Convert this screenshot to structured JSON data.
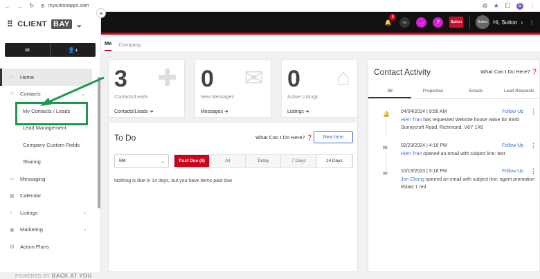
{
  "browser": {
    "url": "mysuttonapps.com",
    "profile_initial": "S"
  },
  "brand": {
    "name": "CLIENT",
    "accent": "BAY"
  },
  "sidebar": {
    "items": [
      {
        "label": "Home",
        "icon": "home-icon"
      },
      {
        "label": "Contacts",
        "icon": "contacts-icon"
      },
      {
        "label": "My Contacts / Leads"
      },
      {
        "label": "Lead Management"
      },
      {
        "label": "Company Custom Fields"
      },
      {
        "label": "Sharing"
      },
      {
        "label": "Messaging",
        "icon": "messaging-icon"
      },
      {
        "label": "Calendar",
        "icon": "calendar-icon"
      },
      {
        "label": "Listings",
        "icon": "listings-icon"
      },
      {
        "label": "Marketing",
        "icon": "marketing-icon"
      },
      {
        "label": "Action Plans",
        "icon": "action-plans-icon"
      }
    ],
    "powered_by": "POWERED BY",
    "powered_brand": "BACK AT YOU"
  },
  "topbar": {
    "notification_count": "8",
    "user_greeting": "Hi, Sutton",
    "brand_badge": "Sutton",
    "avatar_text": "Sutton"
  },
  "tabs": {
    "me": "Me",
    "company": "Company"
  },
  "stats": [
    {
      "value": "3",
      "label": "Contacts/Leads",
      "link": "Contacts/Leads"
    },
    {
      "value": "0",
      "label": "New Messages",
      "link": "Messages"
    },
    {
      "value": "0",
      "label": "Active Listings",
      "link": "Listings"
    }
  ],
  "todo": {
    "title": "To Do",
    "what": "What Can I Do Here?",
    "new_item": "New Item",
    "filter": "Me",
    "ranges": [
      "Past Due (8)",
      "All",
      "Today",
      "7 Days",
      "14 Days"
    ],
    "message": "Nothing is due in 14 days, but you have items past due"
  },
  "activity": {
    "title": "Contact Activity",
    "what": "What Can I Do Here?",
    "tabs": [
      "All",
      "Properties",
      "Emails",
      "Lead Requests"
    ],
    "follow_up": "Follow Up",
    "entries": [
      {
        "date": "04/04/2024",
        "time": "9:50 AM",
        "name": "Hien Tran",
        "text": " has requested Website house value for 8340 Sunnycroft Road, Richmond, V6Y 1X6"
      },
      {
        "date": "02/23/2024",
        "time": "4:18 PM",
        "name": "Hien Tran",
        "text": " opened an email with subject line: test"
      },
      {
        "date": "10/19/2023",
        "time": "5:18 PM",
        "name": "Jon Chung",
        "text": " opened an email with subject line: agent promotion eblast 1 red"
      }
    ]
  },
  "colors": {
    "brand_red": "#d0021b",
    "link_blue": "#3a6fd8",
    "highlight_green": "#1a9a4a"
  }
}
